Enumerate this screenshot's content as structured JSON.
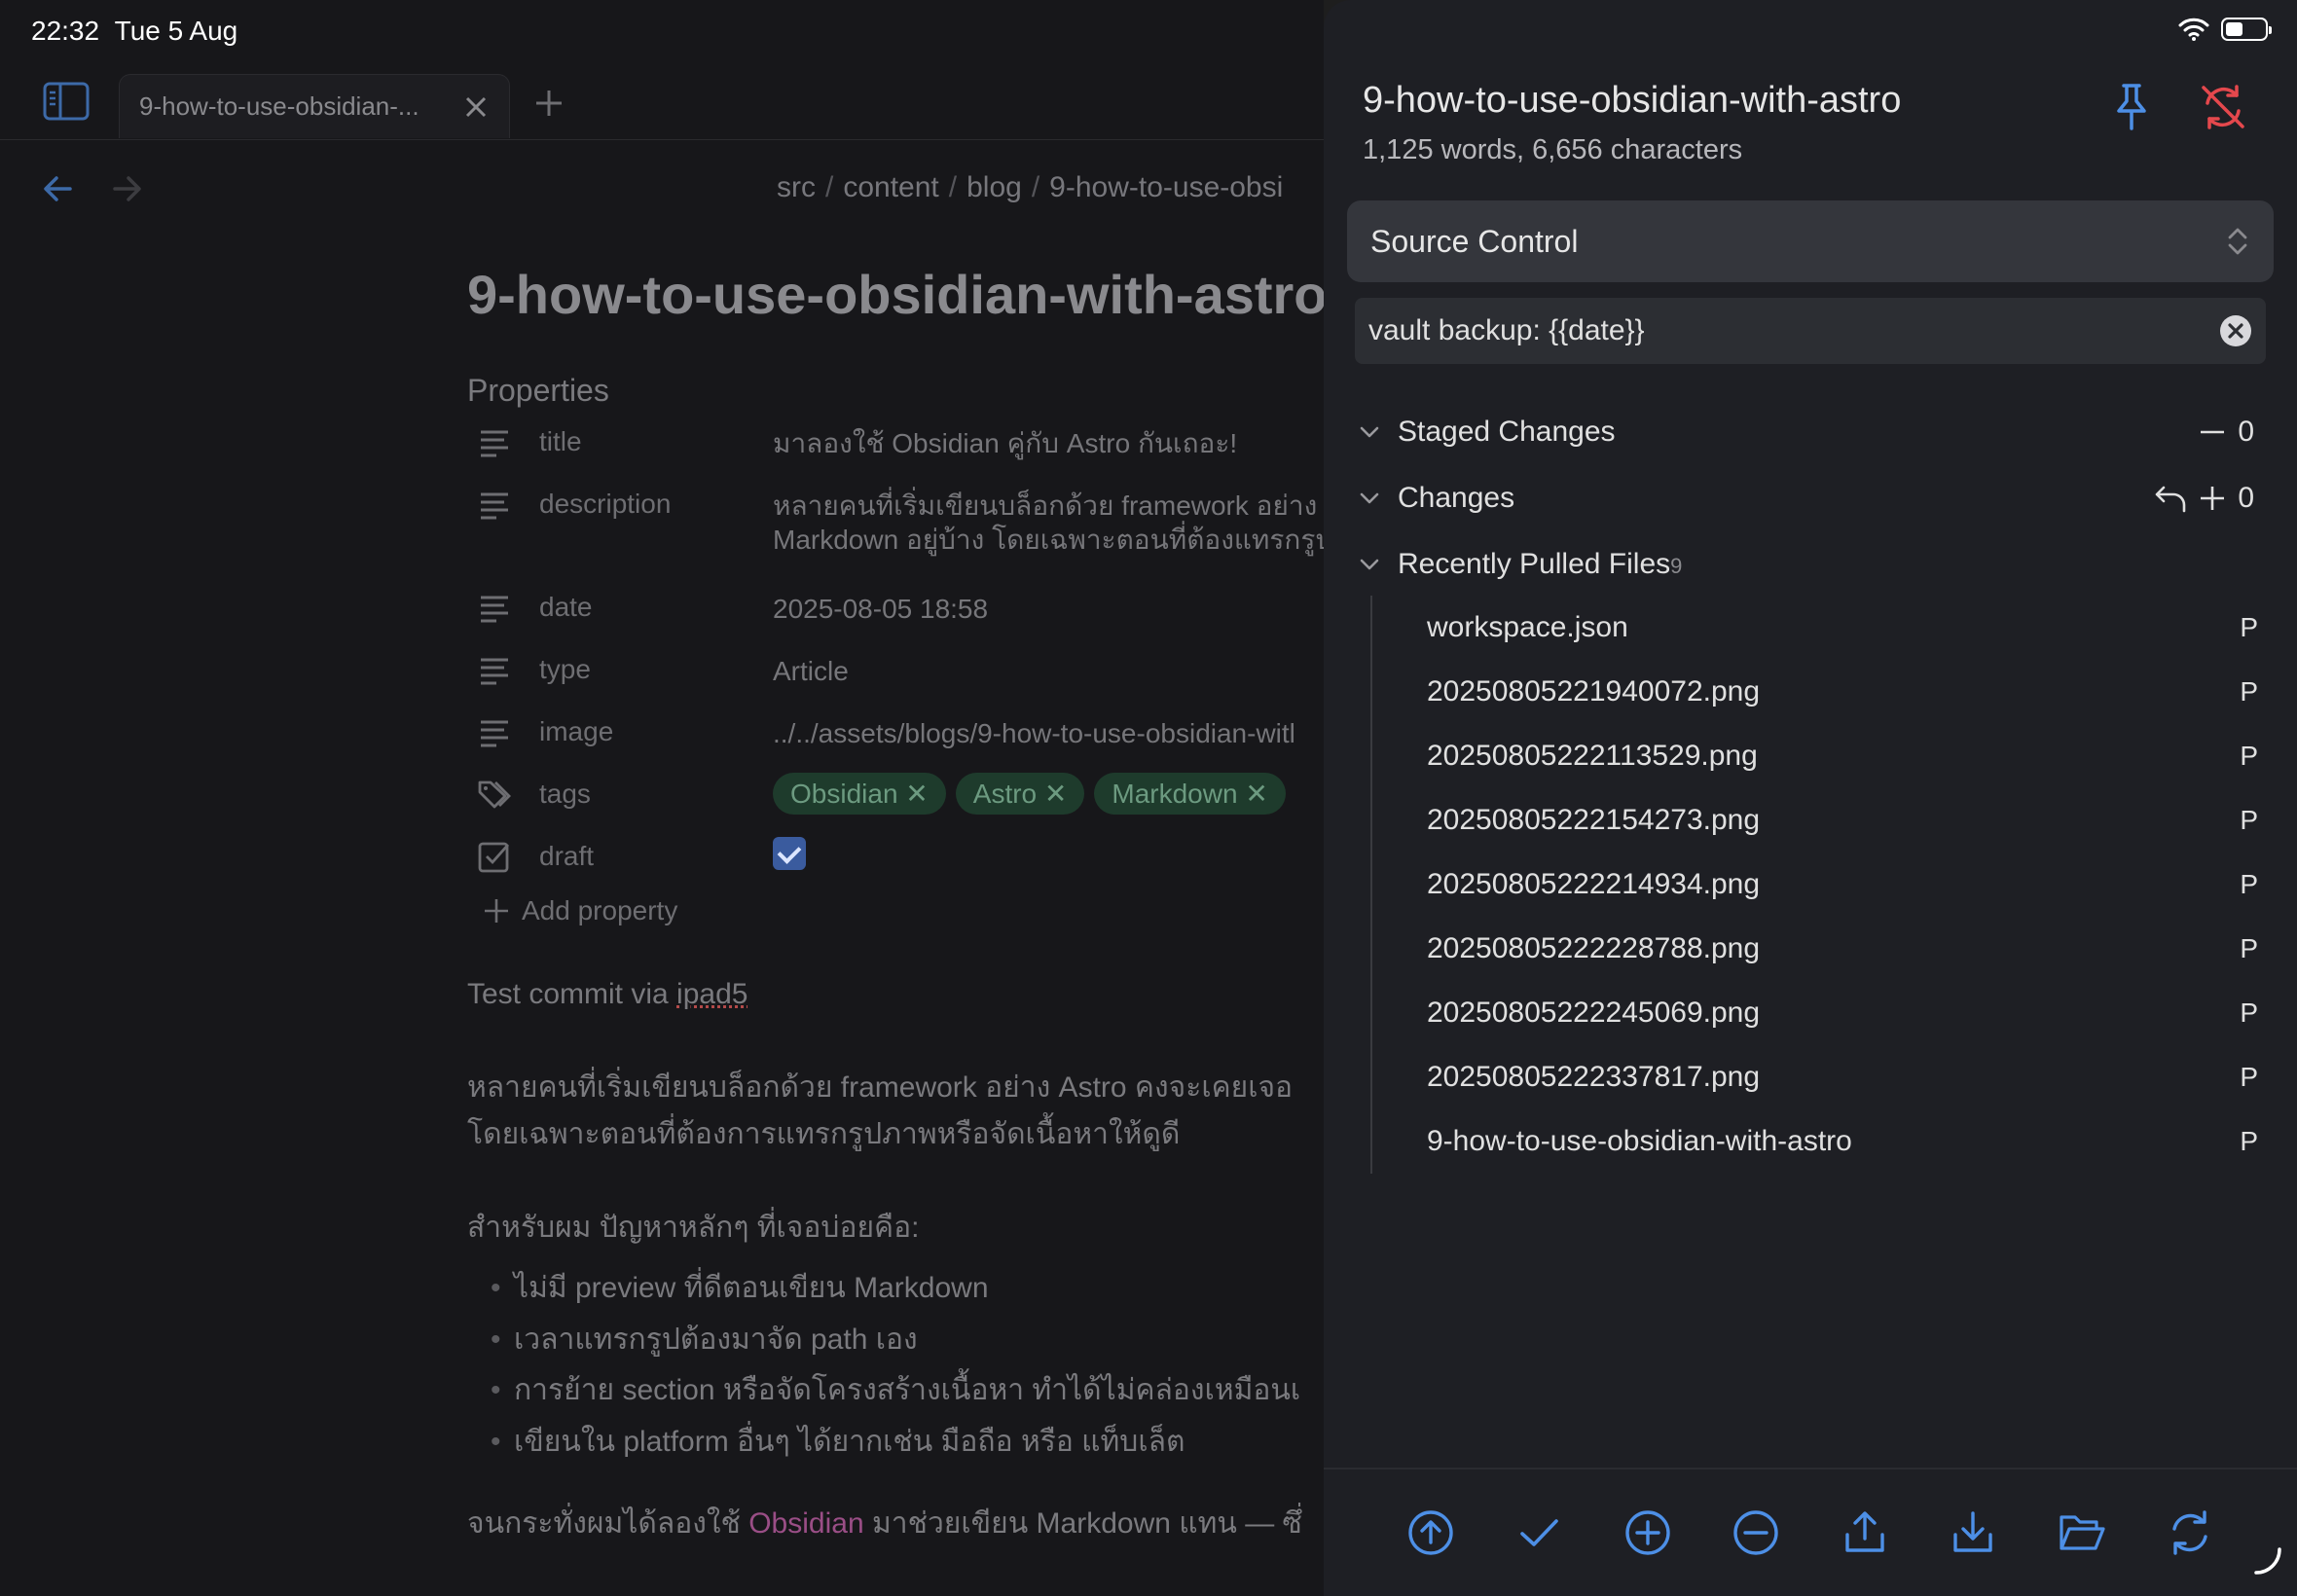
{
  "status_bar": {
    "time": "22:32",
    "date": "Tue 5 Aug",
    "battery_level": 0.45
  },
  "editor": {
    "tab_label": "9-how-to-use-obsidian-...",
    "breadcrumb": [
      "src",
      "content",
      "blog",
      "9-how-to-use-obsi"
    ],
    "title": "9-how-to-use-obsidian-with-astro",
    "properties_heading": "Properties",
    "properties": [
      {
        "key": "title",
        "icon": "text-lines-icon",
        "value": "มาลองใช้ Obsidian คู่กับ Astro กันเถอะ!"
      },
      {
        "key": "description",
        "icon": "text-lines-icon",
        "value": "หลายคนที่เริ่มเขียนบล็อกด้วย framework อย่าง A",
        "value2": "Markdown อยู่บ้าง โดยเฉพาะตอนที่ต้องแทรกรูปภ"
      },
      {
        "key": "date",
        "icon": "text-lines-icon",
        "value": "2025-08-05 18:58"
      },
      {
        "key": "type",
        "icon": "text-lines-icon",
        "value": "Article"
      },
      {
        "key": "image",
        "icon": "text-lines-icon",
        "value": "../../assets/blogs/9-how-to-use-obsidian-witl"
      },
      {
        "key": "tags",
        "icon": "tags-icon",
        "tags": [
          "Obsidian",
          "Astro",
          "Markdown"
        ]
      },
      {
        "key": "draft",
        "icon": "checkbox-icon",
        "checked": true
      }
    ],
    "add_property": "Add property",
    "body": {
      "p1_prefix": "Test commit via ",
      "p1_word": "ipad5",
      "p2_line1": "หลายคนที่เริ่มเขียนบล็อกด้วย framework อย่าง Astro คงจะเคยเจอ",
      "p2_line2": "โดยเฉพาะตอนที่ต้องการแทรกรูปภาพหรือจัดเนื้อหาให้ดูดี",
      "p3": "สำหรับผม ปัญหาหลักๆ ที่เจอบ่อยคือ:",
      "bullets": [
        "ไม่มี preview ที่ดีตอนเขียน Markdown",
        "เวลาแทรกรูปต้องมาจัด path เอง",
        "การย้าย section หรือจัดโครงสร้างเนื้อหา ทำได้ไม่คล่องเหมือนเ",
        "เขียนใน platform อื่นๆ ได้ยากเช่น มือถือ หรือ แท็บเล็ต"
      ],
      "p4_prefix": "จนกระทั่งผมได้ลองใช้ ",
      "p4_link": "Obsidian",
      "p4_suffix": " มาช่วยเขียน Markdown แทน — ซึ่"
    }
  },
  "panel": {
    "title": "9-how-to-use-obsidian-with-astro",
    "stats": "1,125 words, 6,656 characters",
    "view_selector": "Source Control",
    "commit_message": "vault backup: {{date}}",
    "staged": {
      "label": "Staged Changes",
      "count": "0"
    },
    "changes": {
      "label": "Changes",
      "count": "0"
    },
    "recent": {
      "label": "Recently Pulled Files",
      "count": "9"
    },
    "files": [
      {
        "name": "workspace.json",
        "status": "P"
      },
      {
        "name": "20250805221940072.png",
        "status": "P"
      },
      {
        "name": "20250805222113529.png",
        "status": "P"
      },
      {
        "name": "20250805222154273.png",
        "status": "P"
      },
      {
        "name": "20250805222214934.png",
        "status": "P"
      },
      {
        "name": "20250805222228788.png",
        "status": "P"
      },
      {
        "name": "20250805222245069.png",
        "status": "P"
      },
      {
        "name": "20250805222337817.png",
        "status": "P"
      },
      {
        "name": "9-how-to-use-obsidian-with-astro",
        "status": "P"
      }
    ],
    "toolbar": [
      "commit-and-sync-icon",
      "commit-icon",
      "stage-all-icon",
      "unstage-all-icon",
      "push-icon",
      "pull-icon",
      "open-folder-icon",
      "refresh-icon"
    ]
  },
  "colors": {
    "accent": "#4d8fe6",
    "danger": "#e5484d",
    "panel_bg": "#1e1f24",
    "tag_bg": "#1e3b2c"
  }
}
